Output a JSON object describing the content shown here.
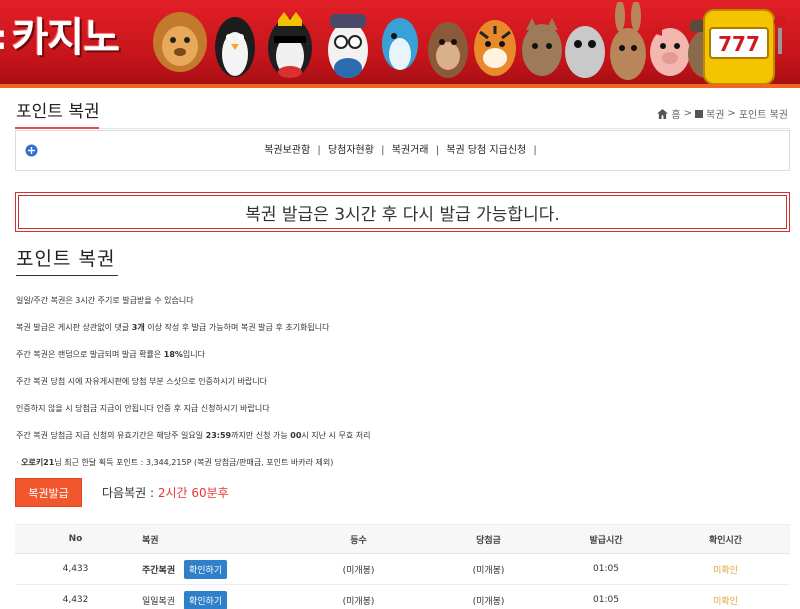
{
  "banner": {
    "brand_prefix": ":",
    "brand_text": "카지노",
    "slot_digits": "777",
    "colors": {
      "primary": "#d0181f",
      "stripe": "#f26522"
    }
  },
  "header": {
    "title": "포인트 복권",
    "breadcrumb": {
      "home": "홈",
      "section": "복권",
      "current": "포인트 복권",
      "separator": ">"
    }
  },
  "submenu": {
    "items": [
      "복권보관함",
      "당첨자현황",
      "복권거래",
      "복권 당첨 지급신청"
    ],
    "separator": "|"
  },
  "notice": {
    "text": "복권 발급은 3시간 후 다시 발급 가능합니다."
  },
  "section": {
    "title": "포인트 복권"
  },
  "info": {
    "line1": "일일/주간 복권은 3시간 주기로 발급받을 수 있습니다",
    "line2_a": "복권 발급은 게시판 상관없이 댓글 ",
    "line2_b": "3개",
    "line2_c": " 이상 작성 후 발급 가능하며 복권 발급 후 초기화됩니다",
    "line3_a": "주간 복권은 랜덤으로 발급되며 발급 확률은 ",
    "line3_b": "18%",
    "line3_c": "입니다",
    "line4": "주간 복권 당첨 시에 자유게시판에 당첨 부분 스샷으로 인증하시기 바랍니다",
    "line5": "인증하지 않을 시 당첨금 지급이 안됩니다 인증 후 지급 신청하시기 바랍니다",
    "line6_a": "주간 복권 당첨금 지급 신청의 유효기간은 해당주 일요일 ",
    "line6_b": "23:59",
    "line6_c": "까지만 신청 가능 ",
    "line6_d": "00",
    "line6_e": "시 지난 시 무효 처리"
  },
  "stats": {
    "bullet": "·",
    "user": "오로키21",
    "text": "님 최근 한달 획득 포인트 : 3,344,215P (복권 당첨금/판매금, 포인트 바카라 제외)"
  },
  "actions": {
    "issue_label": "복권발급",
    "next_label": "다음복권 : ",
    "next_value": "2시간 60분후"
  },
  "table": {
    "headers": [
      "No",
      "복권",
      "등수",
      "당첨금",
      "발급시간",
      "확인시간"
    ],
    "rows": [
      {
        "no": "4,433",
        "kind": "주간복권",
        "bold": true,
        "button": "확인하기",
        "rank": "(미개봉)",
        "prize": "(미개봉)",
        "issued": "01:05",
        "checked": "미확인"
      },
      {
        "no": "4,432",
        "kind": "일일복권",
        "bold": false,
        "button": "확인하기",
        "rank": "(미개봉)",
        "prize": "(미개봉)",
        "issued": "01:05",
        "checked": "미확인"
      }
    ],
    "status_color": "#e6a23c",
    "button_color": "#2f7fc9"
  }
}
